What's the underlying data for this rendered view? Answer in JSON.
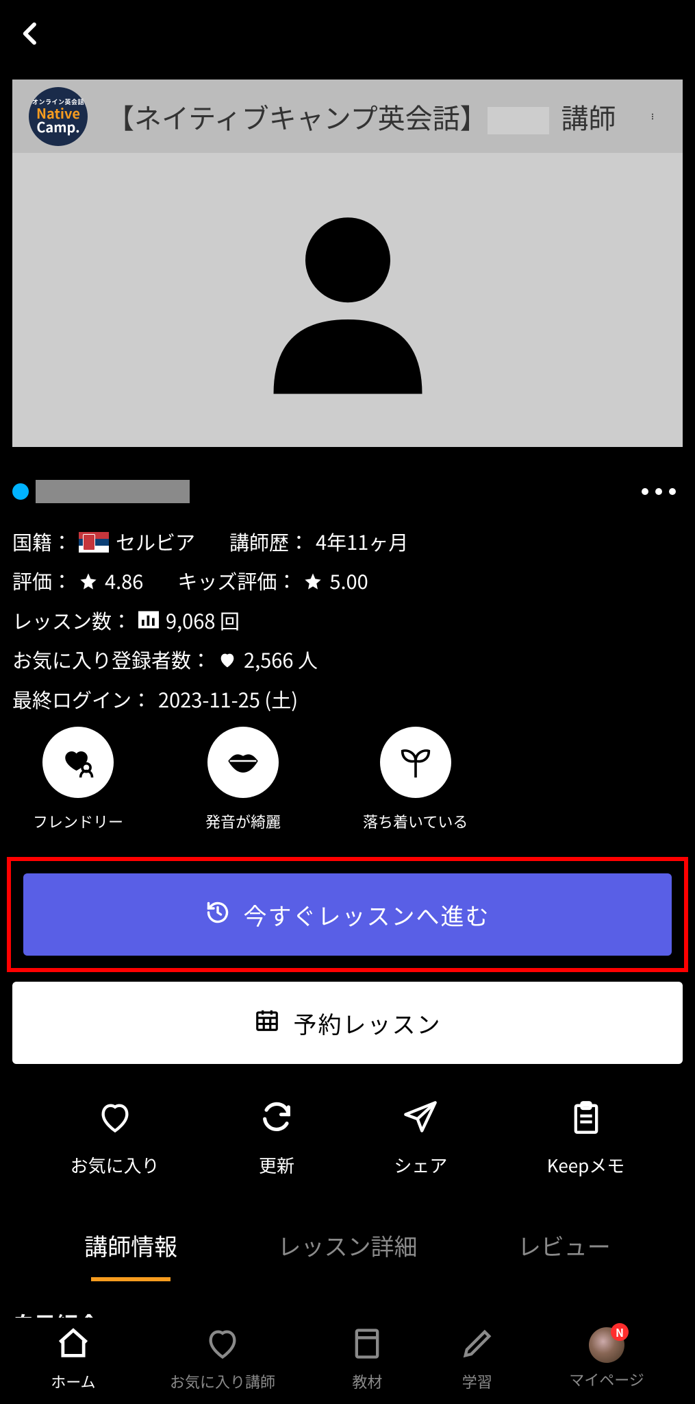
{
  "hero": {
    "brand_top": "オンライン英会話",
    "brand_mid": "Native",
    "brand_bot": "Camp.",
    "title_prefix": "【ネイティブキャンプ英会話】",
    "title_suffix": "講師"
  },
  "profile": {
    "nationality_label": "国籍：",
    "nationality_value": "セルビア",
    "tenure_label": "講師歴：",
    "tenure_value": "4年11ヶ月",
    "rating_label": "評価：",
    "rating_value": "4.86",
    "kids_rating_label": "キッズ評価：",
    "kids_rating_value": "5.00",
    "lessons_label": "レッスン数：",
    "lessons_value": "9,068 回",
    "favorites_label": "お気に入り登録者数：",
    "favorites_value": "2,566 人",
    "last_login_label": "最終ログイン：",
    "last_login_value": "2023-11-25 (土)"
  },
  "traits": [
    {
      "label": "フレンドリー",
      "icon": "heart-person"
    },
    {
      "label": "発音が綺麗",
      "icon": "lips"
    },
    {
      "label": "落ち着いている",
      "icon": "sprout"
    }
  ],
  "cta": {
    "primary": "今すぐレッスンへ進む",
    "secondary": "予約レッスン"
  },
  "actions": {
    "favorite": "お気に入り",
    "refresh": "更新",
    "share": "シェア",
    "keep": "Keepメモ"
  },
  "tabs": {
    "info": "講師情報",
    "detail": "レッスン詳細",
    "review": "レビュー"
  },
  "section": {
    "self_intro": "自己紹介"
  },
  "nav": {
    "home": "ホーム",
    "fav": "お気に入り講師",
    "materials": "教材",
    "study": "学習",
    "mypage": "マイページ",
    "badge": "N"
  }
}
